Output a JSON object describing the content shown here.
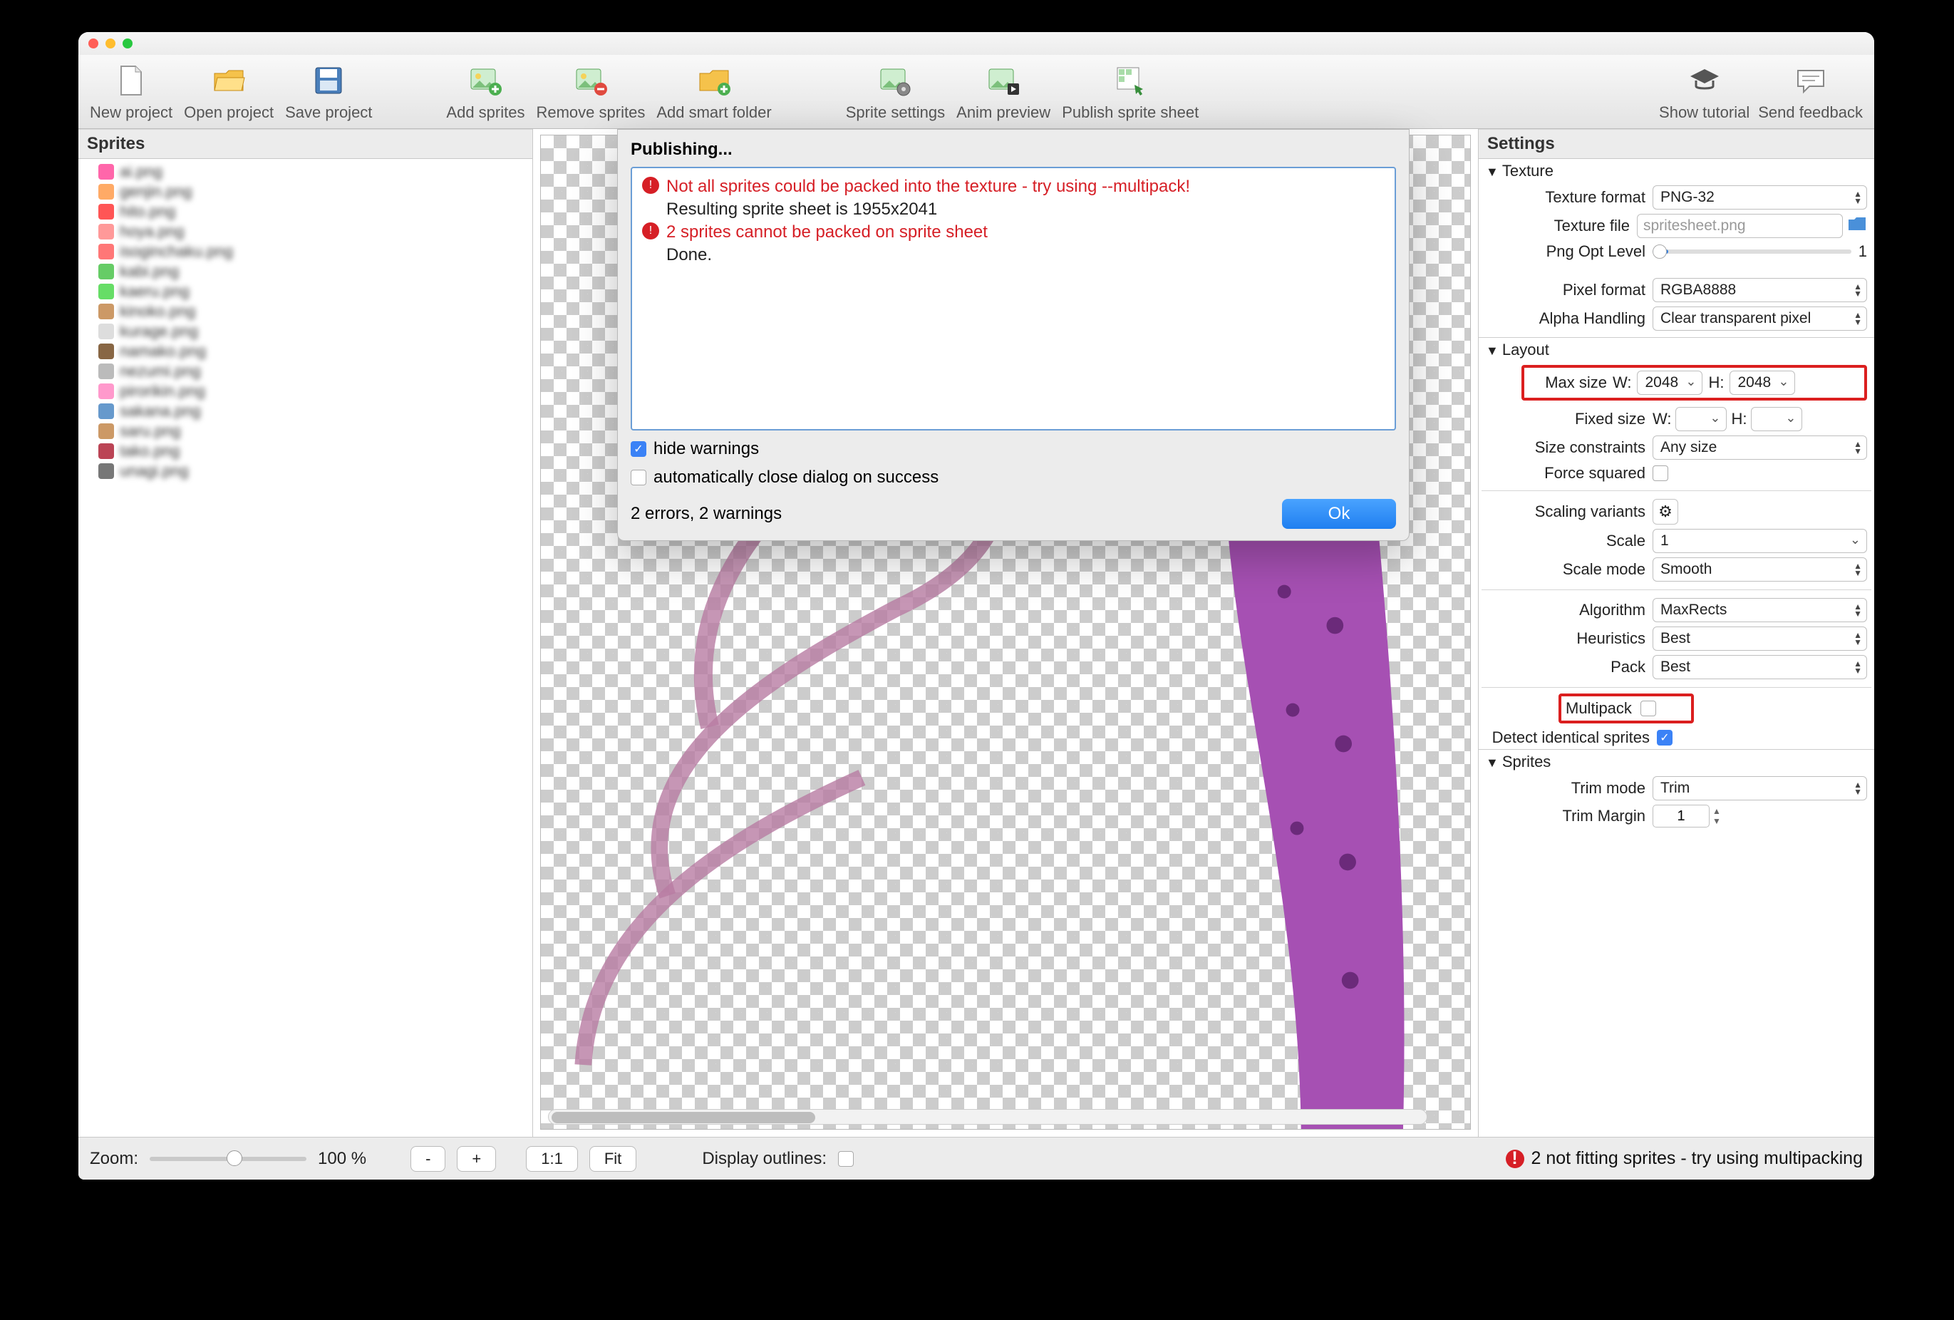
{
  "toolbar": {
    "new_project": "New project",
    "open_project": "Open project",
    "save_project": "Save project",
    "add_sprites": "Add sprites",
    "remove_sprites": "Remove sprites",
    "add_smart_folder": "Add smart folder",
    "sprite_settings": "Sprite settings",
    "anim_preview": "Anim preview",
    "publish": "Publish sprite sheet",
    "show_tutorial": "Show tutorial",
    "send_feedback": "Send feedback"
  },
  "left_panel": {
    "title": "Sprites",
    "files": [
      "ai.png",
      "genjin.png",
      "hito.png",
      "hoya.png",
      "isoginchaku.png",
      "kabi.png",
      "kaeru.png",
      "kinoko.png",
      "kurage.png",
      "namako.png",
      "nezumi.png",
      "pirorikin.png",
      "sakana.png",
      "saru.png",
      "tako.png",
      "unagi.png"
    ]
  },
  "dialog": {
    "title": "Publishing...",
    "lines": [
      {
        "type": "err",
        "text": "Not all sprites could be packed into the texture - try using --multipack!"
      },
      {
        "type": "ok",
        "text": "Resulting sprite sheet is 1955x2041"
      },
      {
        "type": "err",
        "text": "2 sprites cannot be packed on sprite sheet"
      },
      {
        "type": "ok",
        "text": "Done."
      }
    ],
    "hide_warnings_label": "hide warnings",
    "hide_warnings_checked": true,
    "auto_close_label": "automatically close dialog on success",
    "auto_close_checked": false,
    "status": "2 errors, 2 warnings",
    "ok": "Ok"
  },
  "settings": {
    "title": "Settings",
    "texture": {
      "section": "Texture",
      "texture_format_label": "Texture format",
      "texture_format": "PNG-32",
      "texture_file_label": "Texture file",
      "texture_file": "spritesheet.png",
      "png_opt_label": "Png Opt Level",
      "png_opt_value": "1",
      "pixel_format_label": "Pixel format",
      "pixel_format": "RGBA8888",
      "alpha_label": "Alpha Handling",
      "alpha": "Clear transparent pixel"
    },
    "layout": {
      "section": "Layout",
      "max_size_label": "Max size",
      "w_label": "W:",
      "h_label": "H:",
      "max_w": "2048",
      "max_h": "2048",
      "fixed_size_label": "Fixed size",
      "fixed_w": "",
      "fixed_h": "",
      "size_constraints_label": "Size constraints",
      "size_constraints": "Any size",
      "force_squared_label": "Force squared",
      "scaling_variants_label": "Scaling variants",
      "scale_label": "Scale",
      "scale": "1",
      "scale_mode_label": "Scale mode",
      "scale_mode": "Smooth",
      "algorithm_label": "Algorithm",
      "algorithm": "MaxRects",
      "heuristics_label": "Heuristics",
      "heuristics": "Best",
      "pack_label": "Pack",
      "pack": "Best",
      "multipack_label": "Multipack",
      "detect_identical_label": "Detect identical sprites"
    },
    "sprites": {
      "section": "Sprites",
      "trim_mode_label": "Trim mode",
      "trim_mode": "Trim",
      "trim_margin_label": "Trim Margin",
      "trim_margin": "1"
    }
  },
  "footer": {
    "zoom_label": "Zoom:",
    "zoom_value": "100 %",
    "minus": "-",
    "plus": "+",
    "one_to_one": "1:1",
    "fit": "Fit",
    "display_outlines_label": "Display outlines:",
    "error": "2 not fitting sprites - try using multipacking"
  }
}
